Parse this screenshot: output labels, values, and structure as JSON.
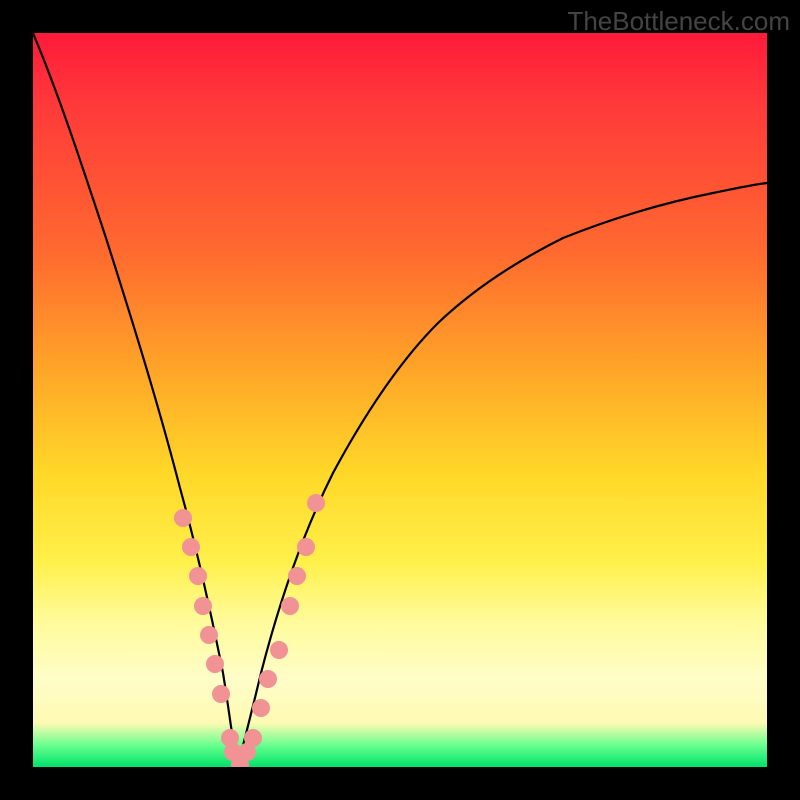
{
  "watermark": "TheBottleneck.com",
  "chart_data": {
    "type": "line",
    "title": "",
    "xlabel": "",
    "ylabel": "",
    "xlim": [
      0,
      1
    ],
    "ylim": [
      0,
      1
    ],
    "legend": false,
    "grid": false,
    "background_gradient": [
      {
        "pos": 0.0,
        "color": "#ff1a3a"
      },
      {
        "pos": 0.3,
        "color": "#ff6a2f"
      },
      {
        "pos": 0.6,
        "color": "#ffd828"
      },
      {
        "pos": 0.88,
        "color": "#fffdc8"
      },
      {
        "pos": 1.0,
        "color": "#00e36b"
      }
    ],
    "series": [
      {
        "name": "curve",
        "type": "line",
        "color": "#000000",
        "x": [
          0.0,
          0.05,
          0.1,
          0.15,
          0.2,
          0.24,
          0.265,
          0.28,
          0.3,
          0.32,
          0.35,
          0.4,
          0.45,
          0.5,
          0.55,
          0.6,
          0.7,
          0.8,
          0.9,
          1.0
        ],
        "y": [
          1.0,
          0.87,
          0.72,
          0.56,
          0.38,
          0.16,
          0.02,
          0.0,
          0.02,
          0.06,
          0.14,
          0.28,
          0.4,
          0.49,
          0.56,
          0.62,
          0.7,
          0.77,
          0.79,
          0.8
        ]
      },
      {
        "name": "markers",
        "type": "scatter",
        "color": "#f19295",
        "x": [
          0.205,
          0.215,
          0.225,
          0.232,
          0.24,
          0.248,
          0.256,
          0.268,
          0.272,
          0.282,
          0.292,
          0.3,
          0.31,
          0.32,
          0.335,
          0.35,
          0.36,
          0.372,
          0.385
        ],
        "y": [
          0.34,
          0.3,
          0.26,
          0.22,
          0.18,
          0.14,
          0.1,
          0.04,
          0.02,
          0.0,
          0.02,
          0.04,
          0.08,
          0.12,
          0.16,
          0.22,
          0.26,
          0.3,
          0.36
        ]
      }
    ]
  }
}
